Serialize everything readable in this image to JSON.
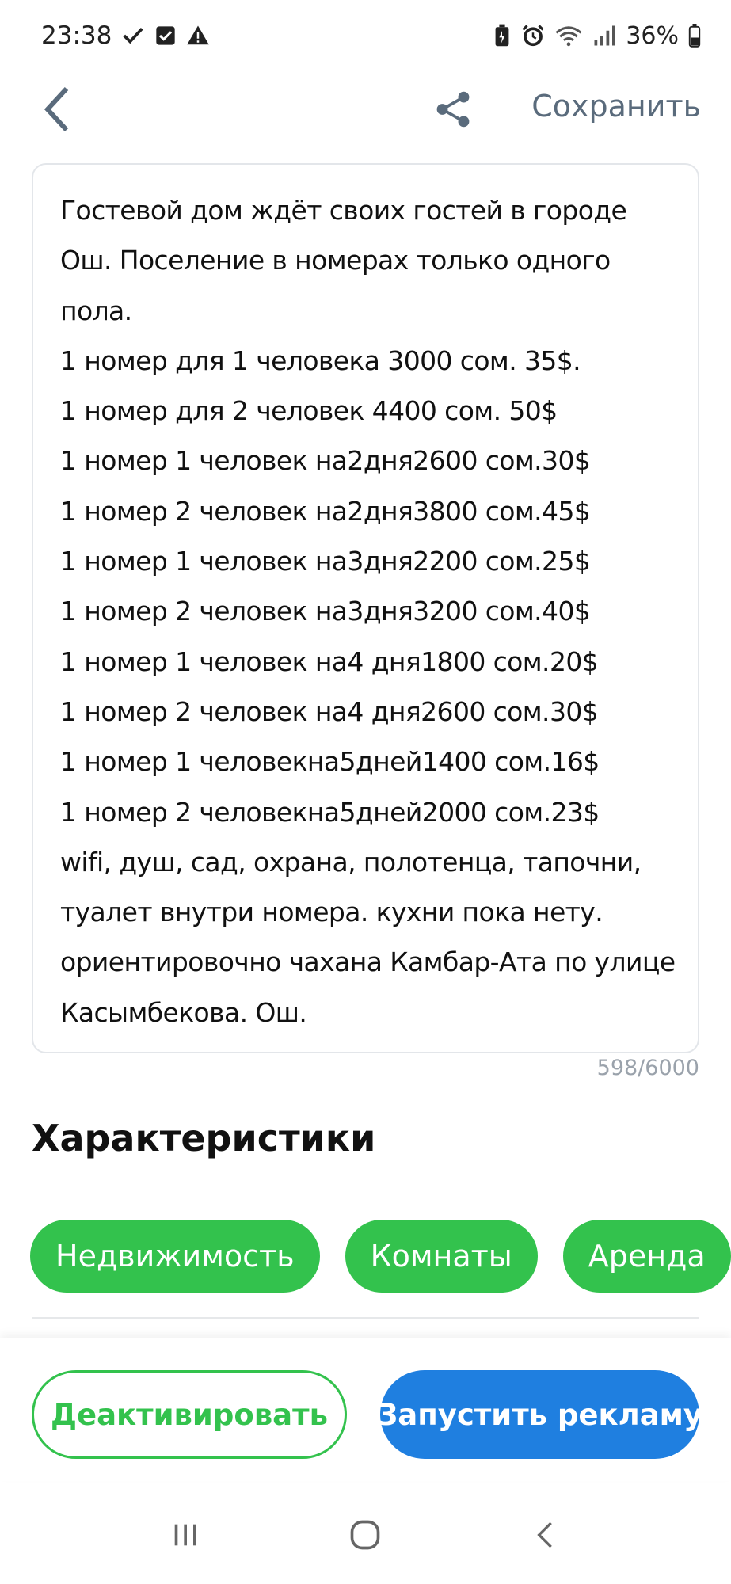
{
  "status_bar": {
    "time": "23:38",
    "battery": "36%",
    "icons": [
      "check-icon",
      "checkbox-icon",
      "warning-icon",
      "battery-saver-icon",
      "alarm-icon",
      "wifi-icon",
      "signal-icon",
      "battery-icon"
    ]
  },
  "top_bar": {
    "back_icon": "chevron-left-icon",
    "share_icon": "share-icon",
    "save_label": "Сохранить"
  },
  "description": {
    "text": "Гостевой дом ждёт своих гостей в городе Ош. Поселение в номерах только одного пола.\n1 номер для 1 человека 3000 сом. 35$.\n1 номер для 2 человек 4400 сом. 50$\n1 номер 1 человек на2дня2600 сом.30$\n1 номер 2 человек на2дня3800 сом.45$\n1 номер 1 человек на3дня2200 сом.25$\n1 номер 2 человек на3дня3200 сом.40$\n1 номер 1 человек на4 дня1800 сом.20$\n1 номер 2 человек на4 дня2600 сом.30$\n1 номер 1 человекна5дней1400 сом.16$\n1 номер 2 человекна5дней2000 сом.23$\nwifi, душ, сад, охрана, полотенца, тапочни, туалет внутри номера. кухни пока нету.  ориентировочно чахана Камбар-Ата по улице Касымбекова. Ош.",
    "counter": "598/6000"
  },
  "characteristics": {
    "title": "Характеристики",
    "chips": [
      "Недвижимость",
      "Комнаты",
      "Аренда"
    ]
  },
  "actions": {
    "deactivate_label": "Деактивировать",
    "ads_label": "Запустить рекламу"
  },
  "colors": {
    "green": "#33c24d",
    "blue": "#1f7fe0",
    "save_text": "#5a6b7c"
  },
  "nav_bar": {
    "icons": [
      "recent-apps-icon",
      "home-icon",
      "back-icon"
    ]
  }
}
